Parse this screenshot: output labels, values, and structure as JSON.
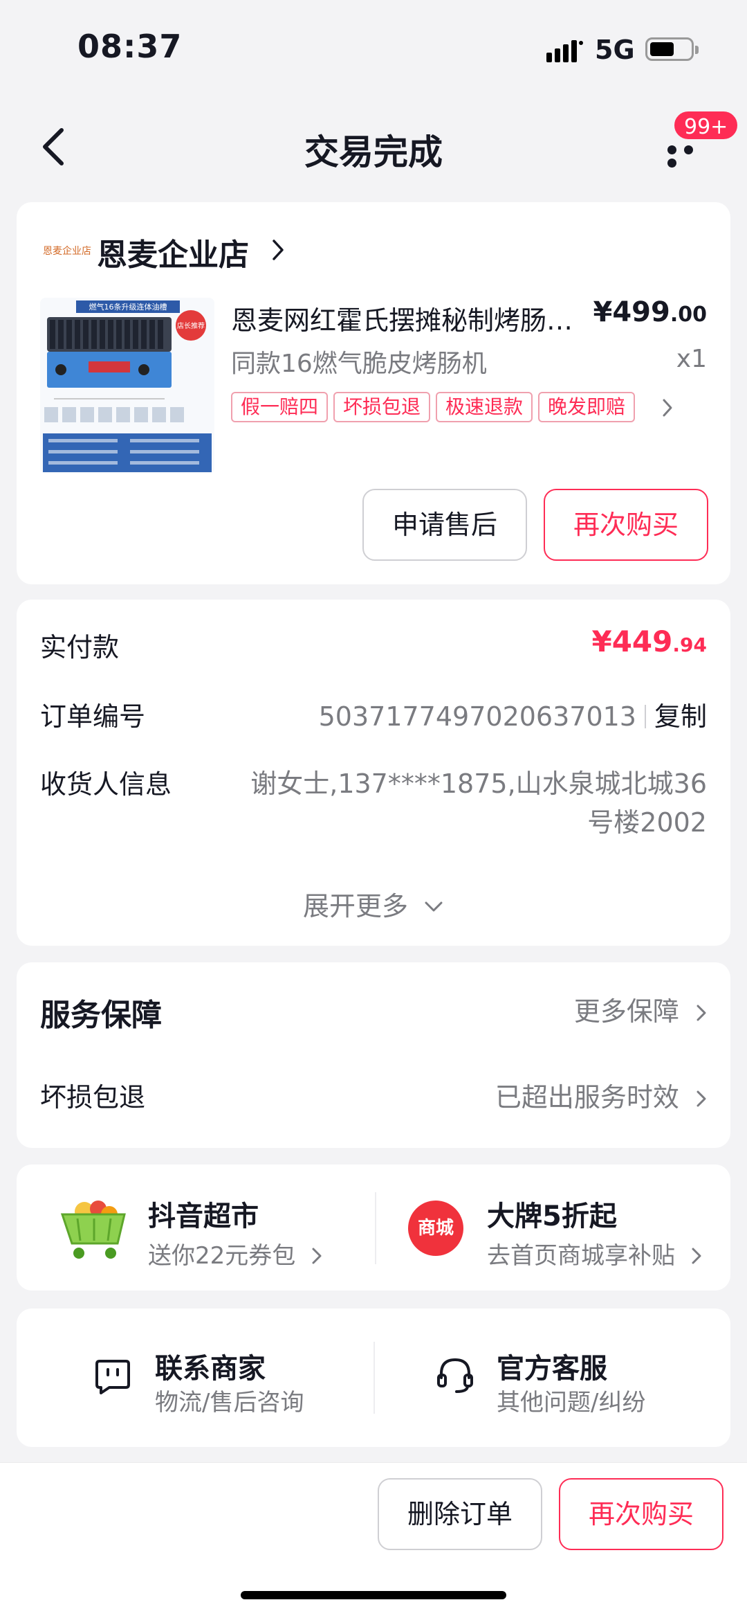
{
  "status": {
    "time": "08:37",
    "network": "5G"
  },
  "nav": {
    "title": "交易完成",
    "badge": "99+"
  },
  "shop": {
    "logo_text": "恩麦企业店",
    "name": "恩麦企业店"
  },
  "product": {
    "title": "恩麦网红霍氏摆摊秘制烤肠机摆摊商用",
    "price_main": "¥499",
    "price_decimal": ".00",
    "spec": "同款16燃气脆皮烤肠机",
    "qty": "x1",
    "tags": [
      "假一赔四",
      "坏损包退",
      "极速退款",
      "晚发即赔"
    ],
    "image_texts": {
      "banner": "燃气16条升级连体油槽",
      "seal": "店长推荐"
    }
  },
  "actions": {
    "after_sale": "申请售后",
    "rebuy": "再次购买"
  },
  "order": {
    "paid_label": "实付款",
    "paid_main": "¥449",
    "paid_decimal": ".94",
    "number_label": "订单编号",
    "number": "5037177497020637013",
    "copy": "复制",
    "receiver_label": "收货人信息",
    "receiver_line1": "谢女士,137****1875,山水泉城北城36",
    "receiver_line2": "号楼2002",
    "expand": "展开更多"
  },
  "service": {
    "title": "服务保障",
    "more": "更多保障",
    "item_label": "坏损包退",
    "item_value": "已超出服务时效"
  },
  "promos": [
    {
      "title": "抖音超市",
      "sub": "送你22元券包"
    },
    {
      "title": "大牌5折起",
      "sub": "去首页商城享补贴",
      "icon_text": "商城"
    }
  ],
  "contact": [
    {
      "title": "联系商家",
      "sub": "物流/售后咨询"
    },
    {
      "title": "官方客服",
      "sub": "其他问题/纠纷"
    }
  ],
  "bottom": {
    "delete": "删除订单",
    "rebuy": "再次购买"
  },
  "colors": {
    "accent": "#fe2c55",
    "background": "#f3f3f5",
    "text_secondary": "#7a7b80"
  }
}
